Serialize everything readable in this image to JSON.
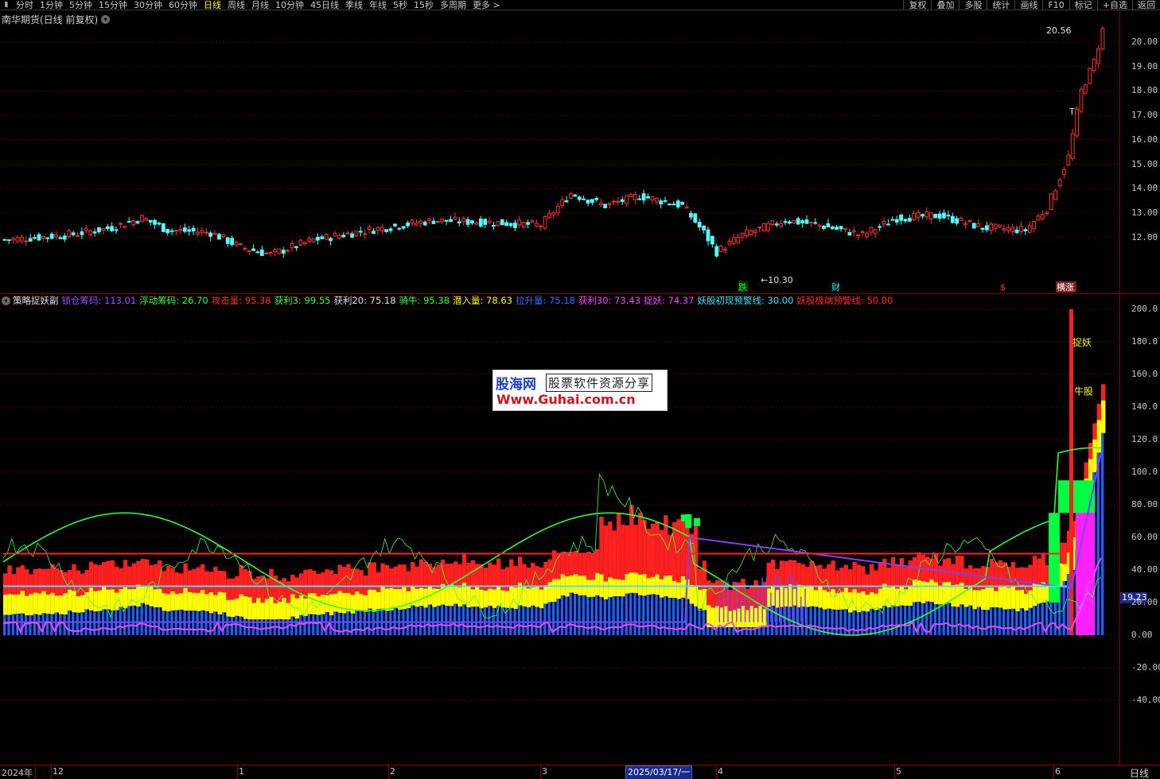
{
  "toolbar": {
    "items": [
      "分时",
      "1分钟",
      "5分钟",
      "15分钟",
      "30分钟",
      "60分钟",
      "日线",
      "周线",
      "月线",
      "10分钟",
      "45日线",
      "季线",
      "年线",
      "5秒",
      "15秒",
      "多周期",
      "更多 >"
    ],
    "active": "日线",
    "buttons": [
      "复权",
      "叠加",
      "多股",
      "统计",
      "画线",
      "F10",
      "标记",
      "+自选",
      "返回"
    ]
  },
  "main_chart": {
    "title": "南华期货(日线 前复权)",
    "high_label": "20.56",
    "low_label": "10.30",
    "t_mark": "T",
    "markers": [
      {
        "text": "跌",
        "color": "#00ff00"
      },
      {
        "text": "财",
        "color": "#00ffff"
      },
      {
        "text": "$",
        "color": "#ff3030"
      },
      {
        "text": "横涨",
        "color": "#ffffff"
      }
    ],
    "yaxis": [
      "20.00",
      "19.00",
      "18.00",
      "17.00",
      "16.00",
      "15.00",
      "14.00",
      "13.00",
      "12.00"
    ]
  },
  "indicator": {
    "name": "策略捉妖副",
    "legend": [
      {
        "label": "锁仓筹码: 113.01",
        "color": "#a050ff"
      },
      {
        "label": "浮动筹码: 26.70",
        "color": "#40ff40"
      },
      {
        "label": "攻击量: 95.38",
        "color": "#ff3030"
      },
      {
        "label": "获利3: 99.55",
        "color": "#40ff40"
      },
      {
        "label": "获利20: 75.18",
        "color": "#e0e0e0"
      },
      {
        "label": "骑牛: 95.38",
        "color": "#40ff40"
      },
      {
        "label": "潜入量: 78.63",
        "color": "#ffff00"
      },
      {
        "label": "拉升量: 75.18",
        "color": "#3070ff"
      },
      {
        "label": "获利30: 73.43",
        "color": "#ff40ff"
      },
      {
        "label": "捉妖: 74.37",
        "color": "#ff40ff"
      },
      {
        "label": "妖股初现预警线: 30.00",
        "color": "#40e0ff"
      },
      {
        "label": "妖股极端预警线: 50.00",
        "color": "#ff3030"
      }
    ],
    "yaxis": [
      "200.0",
      "180.0",
      "160.0",
      "140.0",
      "120.0",
      "100.0",
      "80.00",
      "60.00",
      "40.00",
      "20.00",
      "0.00",
      "-20.00",
      "-40.00"
    ],
    "labels": {
      "zhuoyao": "捉妖",
      "niugu": "牛股"
    },
    "cursor_value": "19.23"
  },
  "watermark": {
    "logo": "股海网",
    "slogan": "股票软件资源分享",
    "url": "Www.Guhai.com.cn"
  },
  "time_axis": {
    "labels": [
      "2024年",
      "12",
      "1",
      "2",
      "3",
      "4",
      "5",
      "6"
    ],
    "selected_date": "2025/03/17/一",
    "period": "日线"
  },
  "colors": {
    "up": "#ff3232",
    "down": "#54ffff",
    "grid": "#8a0000"
  }
}
